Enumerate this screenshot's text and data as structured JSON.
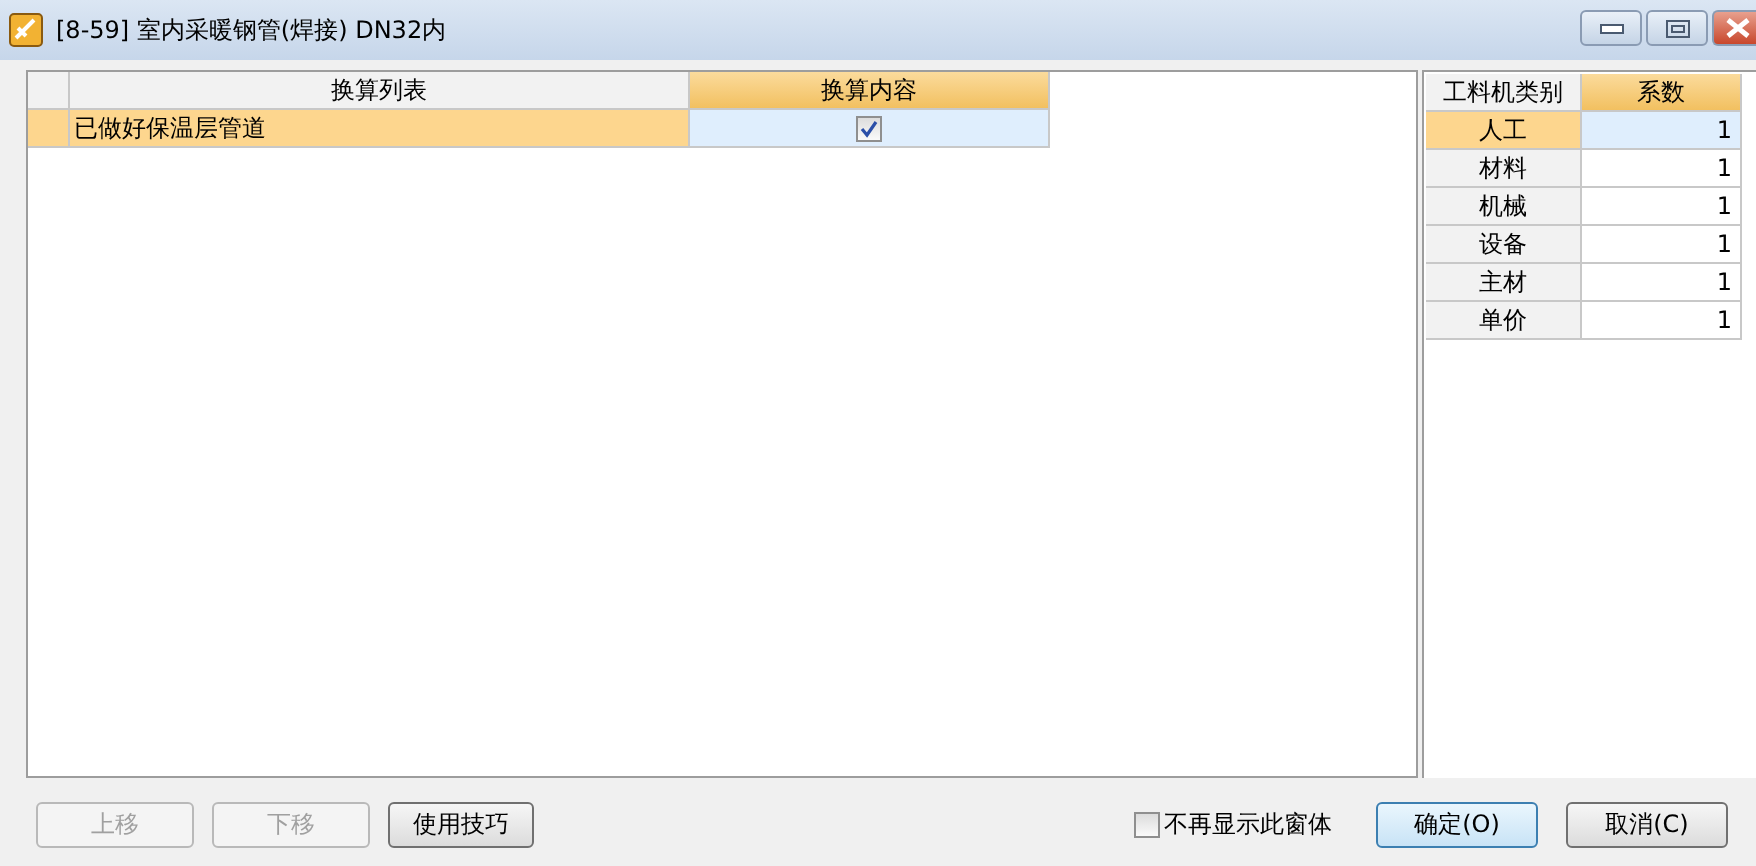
{
  "window": {
    "title": "[8-59]  室内采暖钢管(焊接) DN32内"
  },
  "conversion_table": {
    "columns": [
      "换算列表",
      "换算内容"
    ],
    "rows": [
      {
        "name": "已做好保温层管道",
        "checked": true,
        "selected": true
      }
    ]
  },
  "coefficient_table": {
    "columns": [
      "工料机类别",
      "系数"
    ],
    "rows": [
      {
        "category": "人工",
        "value": "1",
        "selected": true
      },
      {
        "category": "材料",
        "value": "1",
        "selected": false
      },
      {
        "category": "机械",
        "value": "1",
        "selected": false
      },
      {
        "category": "设备",
        "value": "1",
        "selected": false
      },
      {
        "category": "主材",
        "value": "1",
        "selected": false
      },
      {
        "category": "单价",
        "value": "1",
        "selected": false
      }
    ]
  },
  "left_buttons": [
    {
      "label": "上移",
      "disabled": true
    },
    {
      "label": "下移",
      "disabled": true
    },
    {
      "label": "使用技巧",
      "disabled": false
    }
  ],
  "dont_show_again": {
    "label": "不再显示此窗体",
    "checked": false
  },
  "right_buttons": [
    {
      "label": "确定(O)",
      "default": true
    },
    {
      "label": "取消(C)",
      "default": false
    }
  ]
}
